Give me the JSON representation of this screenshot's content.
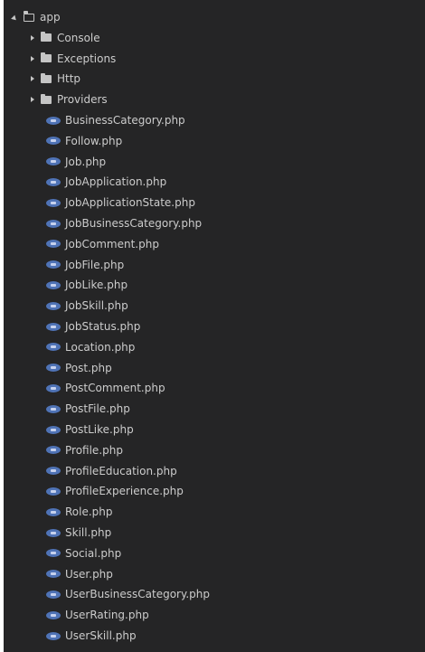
{
  "explorer": {
    "root": {
      "label": "app",
      "icon": "folder-open-icon"
    },
    "folders": [
      {
        "label": "Console",
        "icon": "folder-icon"
      },
      {
        "label": "Exceptions",
        "icon": "folder-icon"
      },
      {
        "label": "Http",
        "icon": "folder-icon"
      },
      {
        "label": "Providers",
        "icon": "folder-icon"
      }
    ],
    "files": [
      {
        "label": "BusinessCategory.php",
        "icon": "php-file-icon"
      },
      {
        "label": "Follow.php",
        "icon": "php-file-icon"
      },
      {
        "label": "Job.php",
        "icon": "php-file-icon"
      },
      {
        "label": "JobApplication.php",
        "icon": "php-file-icon"
      },
      {
        "label": "JobApplicationState.php",
        "icon": "php-file-icon"
      },
      {
        "label": "JobBusinessCategory.php",
        "icon": "php-file-icon"
      },
      {
        "label": "JobComment.php",
        "icon": "php-file-icon"
      },
      {
        "label": "JobFile.php",
        "icon": "php-file-icon"
      },
      {
        "label": "JobLike.php",
        "icon": "php-file-icon"
      },
      {
        "label": "JobSkill.php",
        "icon": "php-file-icon"
      },
      {
        "label": "JobStatus.php",
        "icon": "php-file-icon"
      },
      {
        "label": "Location.php",
        "icon": "php-file-icon"
      },
      {
        "label": "Post.php",
        "icon": "php-file-icon"
      },
      {
        "label": "PostComment.php",
        "icon": "php-file-icon"
      },
      {
        "label": "PostFile.php",
        "icon": "php-file-icon"
      },
      {
        "label": "PostLike.php",
        "icon": "php-file-icon"
      },
      {
        "label": "Profile.php",
        "icon": "php-file-icon"
      },
      {
        "label": "ProfileEducation.php",
        "icon": "php-file-icon"
      },
      {
        "label": "ProfileExperience.php",
        "icon": "php-file-icon"
      },
      {
        "label": "Role.php",
        "icon": "php-file-icon"
      },
      {
        "label": "Skill.php",
        "icon": "php-file-icon"
      },
      {
        "label": "Social.php",
        "icon": "php-file-icon"
      },
      {
        "label": "User.php",
        "icon": "php-file-icon"
      },
      {
        "label": "UserBusinessCategory.php",
        "icon": "php-file-icon"
      },
      {
        "label": "UserRating.php",
        "icon": "php-file-icon"
      },
      {
        "label": "UserSkill.php",
        "icon": "php-file-icon"
      }
    ]
  }
}
